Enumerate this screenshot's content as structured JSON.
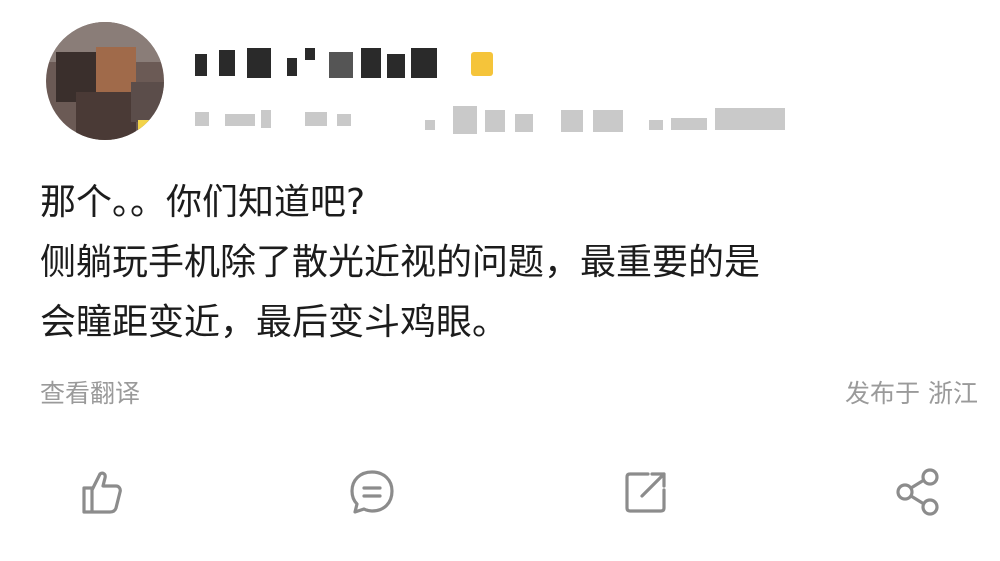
{
  "post": {
    "lines": [
      "那个。。你们知道吧?",
      "侧躺玩手机除了散光近视的问题，最重要的是",
      "会瞳距变近，最后变斗鸡眼。"
    ]
  },
  "footer": {
    "translate_label": "查看翻译",
    "location_label": "发布于 浙江"
  },
  "actions": [
    {
      "name": "like",
      "icon": "thumbs-up-icon"
    },
    {
      "name": "comment",
      "icon": "comment-icon"
    },
    {
      "name": "repost",
      "icon": "repost-icon"
    },
    {
      "name": "share",
      "icon": "share-icon"
    }
  ],
  "colors": {
    "text_primary": "#1c1c1c",
    "text_secondary": "#9a9a9a",
    "icon_gray": "#8c8c8c",
    "badge_yellow": "#f5c43a"
  }
}
